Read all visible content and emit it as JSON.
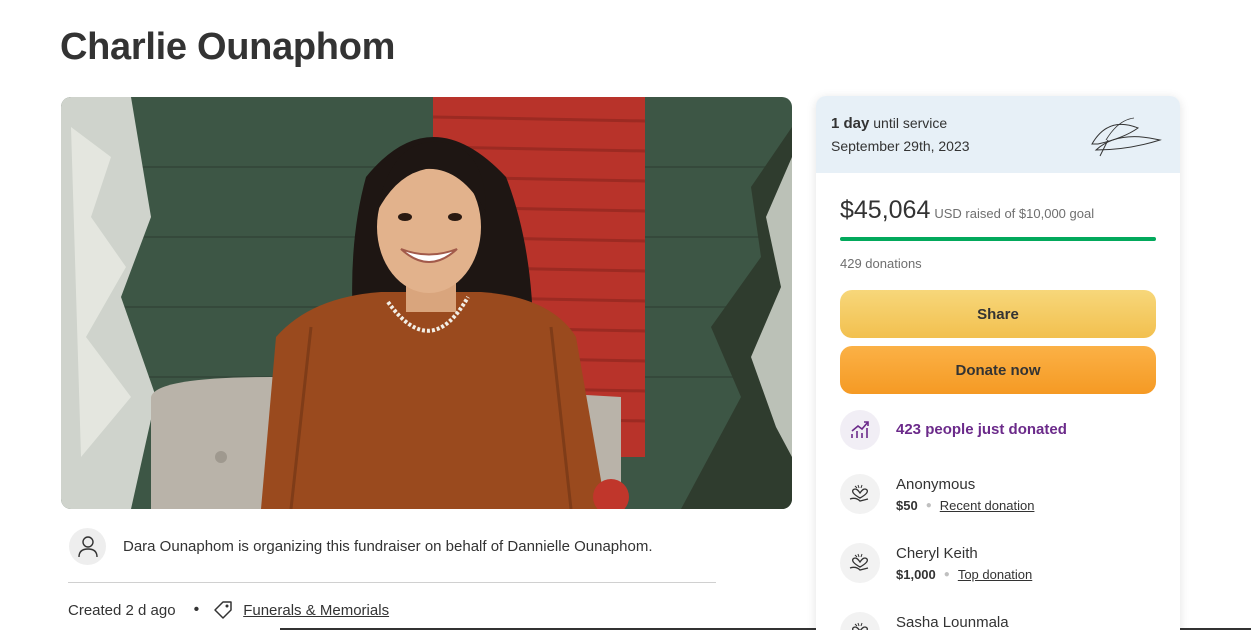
{
  "page": {
    "title": "Charlie Ounaphom"
  },
  "organizer": {
    "text": "Dara Ounaphom is organizing this fundraiser on behalf of Dannielle Ounaphom."
  },
  "meta": {
    "created": "Created 2 d ago",
    "separator": "•",
    "category": "Funerals & Memorials"
  },
  "service": {
    "days_bold": "1 day",
    "days_rest": " until service",
    "date": "September 29th, 2023"
  },
  "funding": {
    "amount": "$45,064",
    "goal_text": "USD raised of $10,000 goal",
    "progress_fraction": 1.0,
    "donations": "429 donations",
    "accent_color": "#02a95c"
  },
  "buttons": {
    "share": "Share",
    "donate": "Donate now"
  },
  "trending": {
    "text": "423 people just donated",
    "color": "#6b2a8a"
  },
  "donors": [
    {
      "name": "Anonymous",
      "amount": "$50",
      "label": "Recent donation"
    },
    {
      "name": "Cheryl Keith",
      "amount": "$1,000",
      "label": "Top donation"
    },
    {
      "name": "Sasha Lounmala",
      "amount": "",
      "label": ""
    }
  ]
}
